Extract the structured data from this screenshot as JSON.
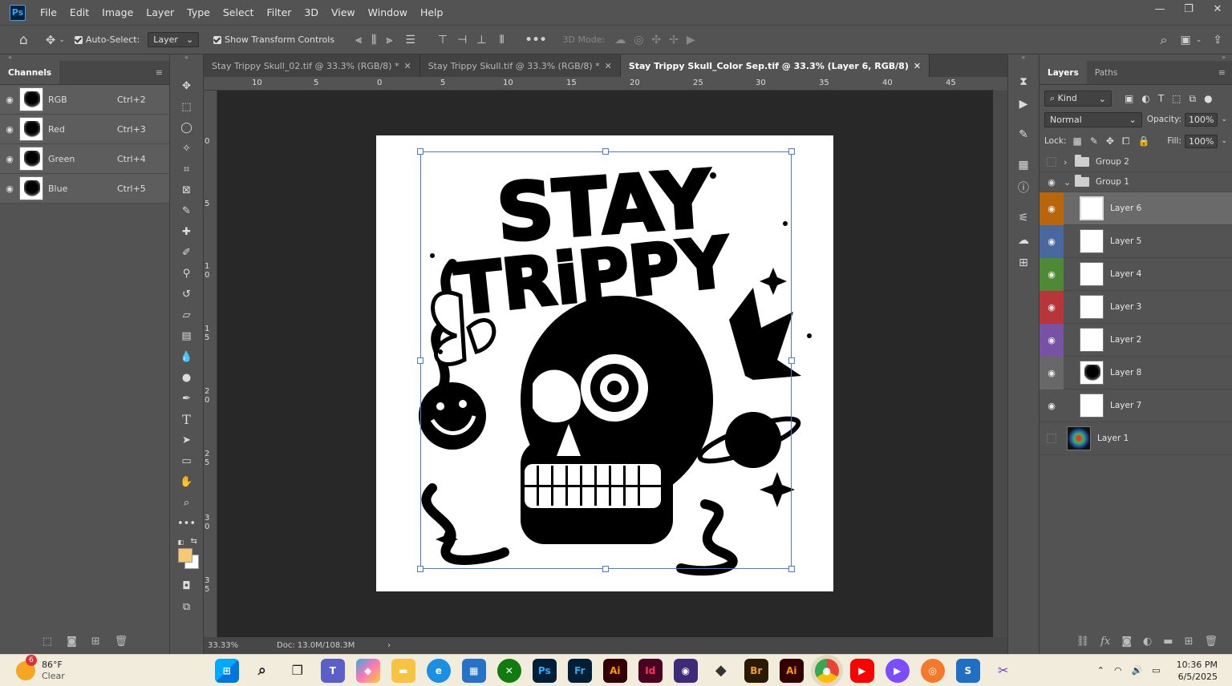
{
  "app": {
    "logo": "Ps",
    "menu": [
      "File",
      "Edit",
      "Image",
      "Layer",
      "Type",
      "Select",
      "Filter",
      "3D",
      "View",
      "Window",
      "Help"
    ]
  },
  "options": {
    "auto_select_label": "Auto-Select:",
    "auto_select_value": "Layer",
    "show_transform_label": "Show Transform Controls",
    "mode_3d_label": "3D Mode:"
  },
  "channels": {
    "tab": "Channels",
    "items": [
      {
        "name": "RGB",
        "shortcut": "Ctrl+2"
      },
      {
        "name": "Red",
        "shortcut": "Ctrl+3"
      },
      {
        "name": "Green",
        "shortcut": "Ctrl+4"
      },
      {
        "name": "Blue",
        "shortcut": "Ctrl+5"
      }
    ]
  },
  "doc_tabs": [
    {
      "label": "Stay Trippy Skull_02.tif @ 33.3% (RGB/8) *"
    },
    {
      "label": "Stay Trippy Skull.tif @ 33.3% (RGB/8) *"
    },
    {
      "label": "Stay Trippy Skull_Color Sep.tif @ 33.3% (Layer 6, RGB/8)"
    }
  ],
  "ruler_top": [
    "10",
    "5",
    "0",
    "5",
    "10",
    "15",
    "20",
    "25",
    "30",
    "35",
    "40",
    "45"
  ],
  "ruler_left": [
    "0",
    "5",
    "1 0",
    "1 5",
    "2 0",
    "2 5",
    "3 0",
    "3 5"
  ],
  "artwork": {
    "line1": "STAY",
    "line2": "TRiPPY"
  },
  "status": {
    "zoom": "33.33%",
    "doc": "Doc: 13.0M/108.3M"
  },
  "layers_panel": {
    "tabs": [
      "Layers",
      "Paths"
    ],
    "filter": "Kind",
    "blend": "Normal",
    "opacity_label": "Opacity:",
    "opacity": "100%",
    "lock_label": "Lock:",
    "fill_label": "Fill:",
    "fill": "100%",
    "groups": [
      {
        "name": "Group 2",
        "expanded": false
      },
      {
        "name": "Group 1",
        "expanded": true
      }
    ],
    "layers": [
      {
        "name": "Layer 6",
        "color": "#b8650c",
        "selected": true
      },
      {
        "name": "Layer 5",
        "color": "#4a68a0"
      },
      {
        "name": "Layer 4",
        "color": "#4e8a35"
      },
      {
        "name": "Layer 3",
        "color": "#b8363a"
      },
      {
        "name": "Layer 2",
        "color": "#7852a5"
      },
      {
        "name": "Layer 8",
        "color": "#686868"
      },
      {
        "name": "Layer 7",
        "color": ""
      }
    ],
    "bottom_layer": "Layer 1"
  },
  "taskbar": {
    "weather_temp": "86°F",
    "weather_text": "Clear",
    "weather_badge": "6",
    "time": "10:36 PM",
    "date": "6/5/2025"
  }
}
